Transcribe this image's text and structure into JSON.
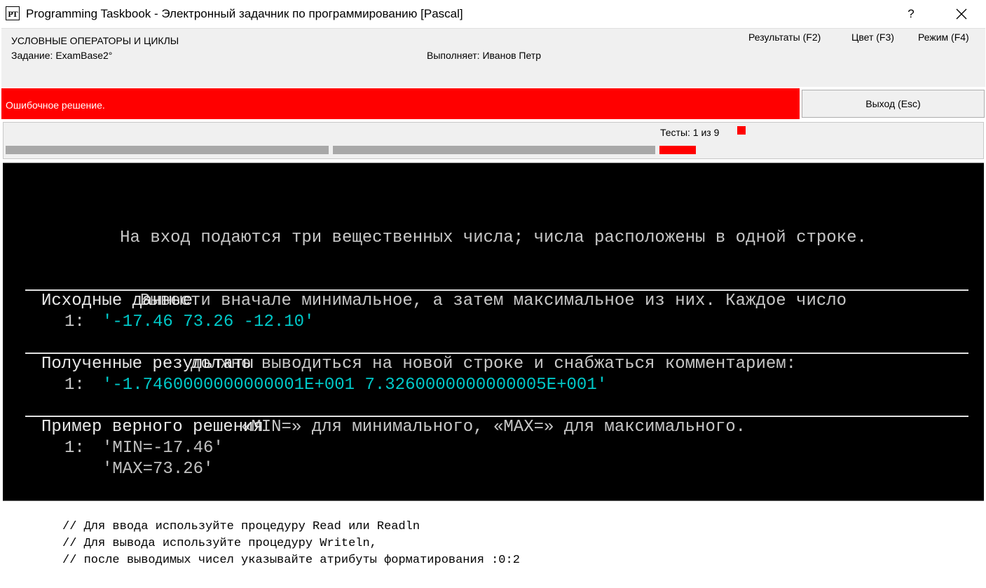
{
  "window": {
    "icon_text": "PT",
    "title": "Programming Taskbook - Электронный задачник по программированию [Pascal]",
    "help": "?"
  },
  "header": {
    "section_title": "УСЛОВНЫЕ ОПЕРАТОРЫ И ЦИКЛЫ",
    "task": "Задание: ExamBase2°",
    "performer": "Выполняет: Иванов Петр",
    "menu": {
      "results": "Результаты (F2)",
      "color": "Цвет (F3)",
      "mode": "Режим (F4)"
    }
  },
  "status": {
    "text": "Ошибочное решение.",
    "color": "#ff0000",
    "exit_label": "Выход (Esc)"
  },
  "tests": {
    "label": "Тесты:  1 из 9",
    "current": 1,
    "total": 9
  },
  "task_description": [
    "На вход подаются три вещественных числа; числа расположены в одной строке.",
    "Вывести вначале минимальное, а затем максимальное из них. Каждое число",
    "должно выводиться на новой строке и снабжаться комментарием:",
    "«MIN=» для минимального, «MAX=» для максимального."
  ],
  "input_data": {
    "title": "Исходные данные",
    "number": "1:",
    "value": "'-17.46 73.26 -12.10'"
  },
  "results": {
    "title": "Полученные результаты",
    "number": "1:",
    "value": "'-1.7460000000000001E+001 7.3260000000000005E+001'"
  },
  "example": {
    "title": "Пример верного решения",
    "number": "1:",
    "line1": "'MIN=-17.46'",
    "line2": "'MAX=73.26'"
  },
  "code_comments": [
    "// Для ввода используйте процедуру Read или Readln",
    "// Для вывода используйте процедуру Writeln,",
    "// после выводимых чисел указывайте атрибуты форматирования :0:2"
  ]
}
